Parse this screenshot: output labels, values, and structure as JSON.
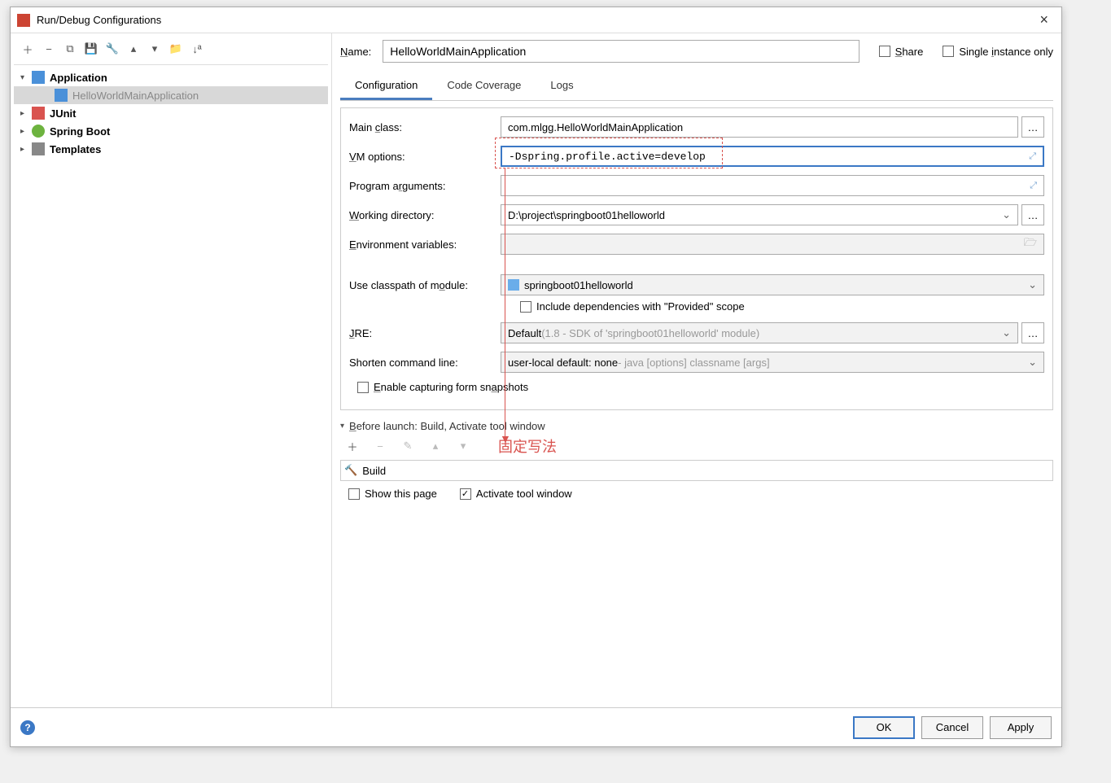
{
  "window": {
    "title": "Run/Debug Configurations"
  },
  "tree": {
    "application": "Application",
    "app_child": "HelloWorldMainApplication",
    "junit": "JUnit",
    "spring": "Spring Boot",
    "templates": "Templates"
  },
  "nameLabel": "Name:",
  "nameValue": "HelloWorldMainApplication",
  "shareLabel": "Share",
  "singleInstanceLabel": "Single instance only",
  "tabs": {
    "config": "Configuration",
    "coverage": "Code Coverage",
    "logs": "Logs"
  },
  "form": {
    "mainClassLabel": "Main class:",
    "mainClassValue": "com.mlgg.HelloWorldMainApplication",
    "vmLabel": "VM options:",
    "vmValue": "-Dspring.profile.active=develop",
    "progArgsLabel": "Program arguments:",
    "progArgsValue": "",
    "workDirLabel": "Working directory:",
    "workDirValue": "D:\\project\\springboot01helloworld",
    "envLabel": "Environment variables:",
    "envValue": "",
    "classpathLabel": "Use classpath of module:",
    "classpathValue": "springboot01helloworld",
    "includeProvided": "Include dependencies with \"Provided\" scope",
    "jreLabel": "JRE:",
    "jreValue": "Default",
    "jreHint": " (1.8 - SDK of 'springboot01helloworld' module)",
    "shortenLabel": "Shorten command line:",
    "shortenValue": "user-local default: none",
    "shortenHint": " - java [options] classname [args]",
    "enableSnapshots": "Enable capturing form snapshots"
  },
  "annotation": "固定写法",
  "beforeLaunch": {
    "header": "Before launch: Build, Activate tool window",
    "buildItem": "Build",
    "showPage": "Show this page",
    "activateWindow": "Activate tool window"
  },
  "buttons": {
    "ok": "OK",
    "cancel": "Cancel",
    "apply": "Apply"
  }
}
